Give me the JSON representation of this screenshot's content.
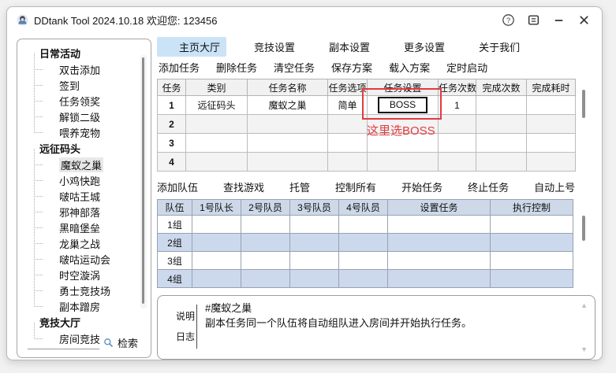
{
  "window": {
    "title": "DDtank Tool 2024.10.18 欢迎您: 123456",
    "controls": [
      {
        "name": "help-button",
        "icon": "help-icon"
      },
      {
        "name": "menu-button",
        "icon": "menu-icon"
      },
      {
        "name": "minimize-button",
        "icon": "minimize-icon"
      },
      {
        "name": "close-button",
        "icon": "close-icon"
      }
    ]
  },
  "sidebar": {
    "groups": [
      {
        "label": "日常活动",
        "icon": "calendar-icon",
        "items": [
          {
            "label": "双击添加",
            "icon": "mouse-icon"
          },
          {
            "label": "签到",
            "icon": "task-doc-icon"
          },
          {
            "label": "任务领奖",
            "icon": "task-doc-icon"
          },
          {
            "label": "解锁二级",
            "icon": "task-doc-icon"
          },
          {
            "label": "喂养宠物",
            "icon": "task-doc-icon"
          }
        ]
      },
      {
        "label": "远征码头",
        "icon": "ship-icon",
        "items": [
          {
            "label": "魔蚁之巢",
            "icon": "task-doc-icon",
            "selected": true
          },
          {
            "label": "小鸡快跑",
            "icon": "task-doc-icon"
          },
          {
            "label": "啵咕王城",
            "icon": "task-doc-icon"
          },
          {
            "label": "邪神部落",
            "icon": "task-doc-icon"
          },
          {
            "label": "黑暗堡垒",
            "icon": "task-doc-icon"
          },
          {
            "label": "龙巢之战",
            "icon": "task-doc-icon"
          },
          {
            "label": "啵咕运动会",
            "icon": "task-doc-icon"
          },
          {
            "label": "时空漩涡",
            "icon": "task-doc-icon"
          },
          {
            "label": "勇士竞技场",
            "icon": "task-doc-icon"
          },
          {
            "label": "副本蹭房",
            "icon": "task-doc-icon"
          }
        ]
      },
      {
        "label": "竞技大厅",
        "icon": "swords-icon",
        "items": [
          {
            "label": "房间竞技",
            "icon": "task-doc-icon"
          }
        ]
      }
    ],
    "search_label": "检索",
    "search_icon": "search-icon"
  },
  "tabs": [
    {
      "label": "主页大厅",
      "icon": "home-icon",
      "active": true
    },
    {
      "label": "竞技设置",
      "icon": "swords-icon",
      "active": false
    },
    {
      "label": "副本设置",
      "icon": "ship-icon",
      "active": false
    },
    {
      "label": "更多设置",
      "icon": "grid-icon",
      "active": false
    },
    {
      "label": "关于我们",
      "icon": "info-icon",
      "active": false
    }
  ],
  "task_menu": [
    "添加任务",
    "删除任务",
    "清空任务",
    "保存方案",
    "载入方案",
    "定时启动"
  ],
  "task_table": {
    "headers": [
      "任务",
      "类别",
      "任务名称",
      "任务选项",
      "任务设置",
      "任务次数",
      "完成次数",
      "完成耗时"
    ],
    "emphasized_header_index": 4,
    "combo_cell": {
      "row": 0,
      "col": 4
    },
    "rows": [
      [
        "1",
        "远征码头",
        "魔蚁之巢",
        "简单",
        "BOSS",
        "1",
        "",
        ""
      ],
      [
        "2",
        "",
        "",
        "",
        "",
        "",
        "",
        ""
      ],
      [
        "3",
        "",
        "",
        "",
        "",
        "",
        "",
        ""
      ],
      [
        "4",
        "",
        "",
        "",
        "",
        "",
        "",
        ""
      ]
    ],
    "annotation": {
      "text": "这里选BOSS",
      "color": "#e23a40"
    }
  },
  "team_toolbar": [
    {
      "label": "添加队伍",
      "icon": null
    },
    {
      "label": "查找游戏",
      "icon": "magnifier-icon"
    },
    {
      "label": "托管",
      "icon": "robot-icon"
    },
    {
      "label": "控制所有",
      "icon": "check-circle-icon"
    },
    {
      "label": "开始任务",
      "icon": "play-icon"
    },
    {
      "label": "终止任务",
      "icon": "stop-icon"
    },
    {
      "label": "自动上号",
      "icon": "refresh-icon"
    }
  ],
  "team_table": {
    "headers": [
      "队伍",
      "1号队长",
      "2号队员",
      "3号队员",
      "4号队员",
      "设置任务",
      "执行控制"
    ],
    "rows": [
      [
        "1组",
        "",
        "",
        "",
        "",
        "",
        ""
      ],
      [
        "2组",
        "",
        "",
        "",
        "",
        "",
        ""
      ],
      [
        "3组",
        "",
        "",
        "",
        "",
        "",
        ""
      ],
      [
        "4组",
        "",
        "",
        "",
        "",
        "",
        ""
      ]
    ]
  },
  "info_panel": {
    "tabs": [
      {
        "label": "说明",
        "icon": "note-icon"
      },
      {
        "label": "日志",
        "icon": "log-icon"
      }
    ],
    "lines": [
      "#魔蚁之巢",
      "副本任务同一个队伍将自动组队进入房间并开始执行任务。"
    ]
  },
  "colors": {
    "active_tab_bg": "#cbe3f7",
    "annotation_red": "#e23a40",
    "team_header_bg": "#cdd9e8",
    "team_alt_row_bg": "#ccd9ec",
    "task_alt_row_bg": "#f3f3f3"
  }
}
